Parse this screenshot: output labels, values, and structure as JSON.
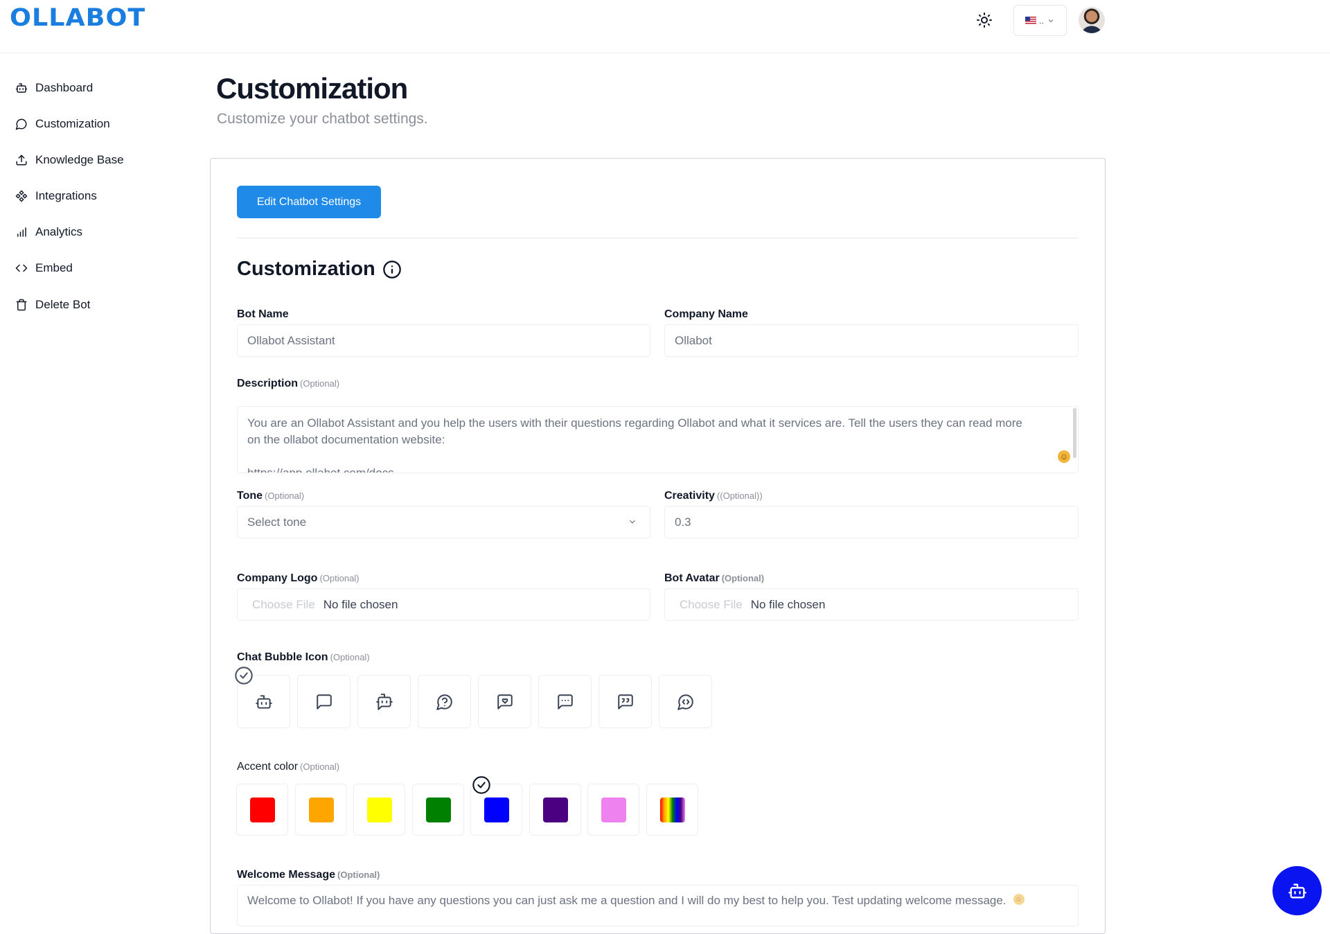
{
  "header": {
    "logo": "OLLABOT",
    "language_flag": "🇺🇸",
    "language_label": ".."
  },
  "sidebar": {
    "items": [
      {
        "label": "Dashboard",
        "icon": "bot-icon"
      },
      {
        "label": "Customization",
        "icon": "message-circle-icon"
      },
      {
        "label": "Knowledge Base",
        "icon": "upload-icon"
      },
      {
        "label": "Integrations",
        "icon": "component-icon"
      },
      {
        "label": "Analytics",
        "icon": "bar-chart-icon"
      },
      {
        "label": "Embed",
        "icon": "code-icon"
      },
      {
        "label": "Delete Bot",
        "icon": "trash-icon"
      }
    ]
  },
  "main": {
    "title": "Customization",
    "subtitle": "Customize your chatbot settings.",
    "edit_button": "Edit Chatbot Settings",
    "section_title": "Customization",
    "bot_name": {
      "label": "Bot Name",
      "value": "Ollabot Assistant"
    },
    "company_name": {
      "label": "Company Name",
      "value": "Ollabot"
    },
    "description": {
      "label": "Description",
      "optional": "(Optional)",
      "line1": "You are an Ollabot Assistant and you help the users with their questions regarding Ollabot and what it services are. Tell the users they can read more",
      "line2": "on the ollabot documentation website:",
      "line3": "https://app.ollabot.com/docs"
    },
    "tone": {
      "label": "Tone",
      "optional": "(Optional)",
      "placeholder": "Select tone"
    },
    "creativity": {
      "label": "Creativity",
      "optional": "((Optional))",
      "value": "0.3"
    },
    "company_logo": {
      "label": "Company Logo",
      "optional": "(Optional)",
      "choose": "Choose File",
      "status": "No file chosen"
    },
    "bot_avatar": {
      "label": "Bot Avatar",
      "optional": "(Optional)",
      "choose": "Choose File",
      "status": "No file chosen"
    },
    "chat_bubble": {
      "label": "Chat Bubble Icon",
      "optional": "(Optional)",
      "selected_index": 0,
      "icons": [
        "bot-icon",
        "message-square-icon",
        "bot-message-icon",
        "message-question-icon",
        "message-heart-icon",
        "message-dots-icon",
        "message-quote-icon",
        "message-code-icon"
      ]
    },
    "accent": {
      "label": "Accent color",
      "optional": "(Optional)",
      "selected_index": 4,
      "colors": [
        "#ff0000",
        "#ffa500",
        "#ffff00",
        "#008000",
        "#0000ff",
        "#4b0082",
        "#ee82ee",
        "rainbow"
      ]
    },
    "welcome": {
      "label": "Welcome Message",
      "optional": "(Optional)",
      "value": "Welcome to Ollabot! If you have any questions you can just ask me a question and I will do my best to help you. Test updating welcome message."
    }
  }
}
